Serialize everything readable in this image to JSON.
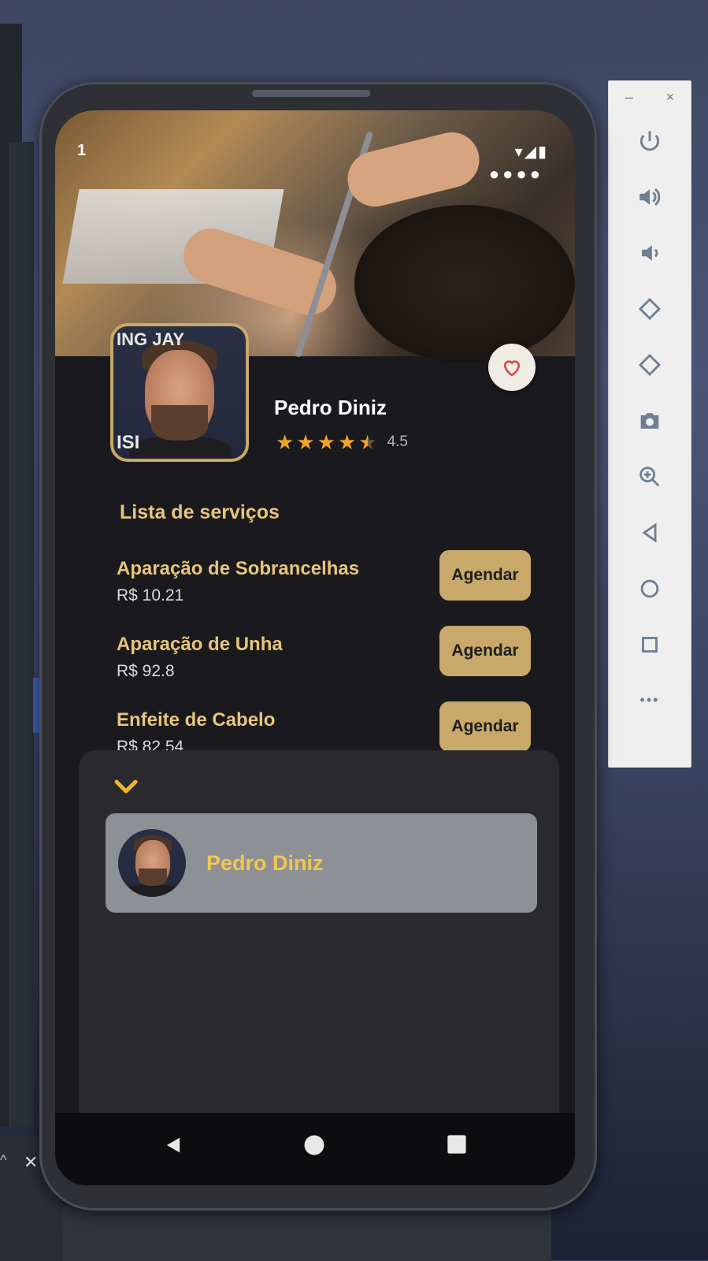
{
  "status_bar": {
    "time": "1",
    "signal": "▾◢▮",
    "dots": "●●●●"
  },
  "profile": {
    "name": "Pedro Diniz",
    "rating": "4.5",
    "rating_value": 4.5,
    "avatar_text_top": "ING JAY",
    "avatar_text_bottom": "ISI"
  },
  "section_title": "Lista de serviços",
  "services": [
    {
      "name": "Aparação de Sobrancelhas",
      "price": "R$ 10.21",
      "button": "Agendar"
    },
    {
      "name": "Aparação de Unha",
      "price": "R$ 92.8",
      "button": "Agendar"
    },
    {
      "name": "Enfeite de Cabelo",
      "price": "R$ 82.54",
      "button": "Agendar"
    }
  ],
  "sheet": {
    "professional_name": "Pedro Diniz"
  },
  "colors": {
    "accent": "#c8a96a",
    "gold_text": "#e8c57a",
    "star": "#f0a329",
    "background": "#1a1a1e",
    "sheet": "#2a2a2e",
    "card": "#8d9195"
  },
  "icons": {
    "favorite": "heart-icon",
    "collapse": "chevron-down-icon",
    "nav_back": "triangle-back-icon",
    "nav_home": "circle-home-icon",
    "nav_recents": "square-recents-icon"
  },
  "emulator_toolbar": {
    "close": "×",
    "minimize": "–",
    "more": "•••"
  }
}
